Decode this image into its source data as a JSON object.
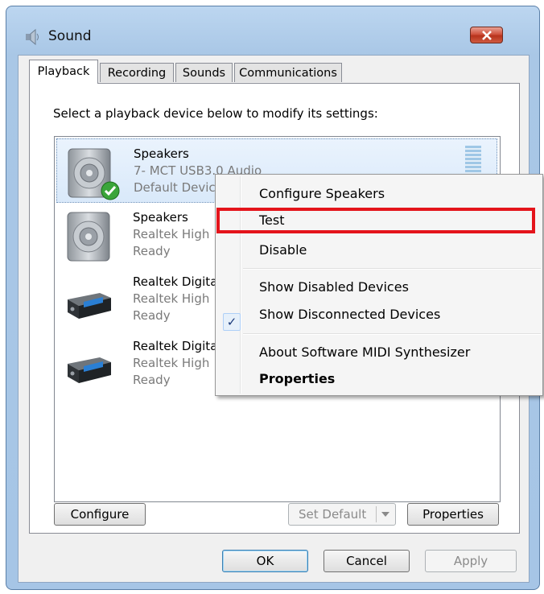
{
  "window": {
    "title": "Sound",
    "icon": "speaker-icon"
  },
  "tabs": [
    {
      "label": "Playback",
      "active": true
    },
    {
      "label": "Recording"
    },
    {
      "label": "Sounds"
    },
    {
      "label": "Communications"
    }
  ],
  "instructions": "Select a playback device below to modify its settings:",
  "devices": [
    {
      "name": "Speakers",
      "line2": "7- MCT USB3.0 Audio",
      "line3": "Default Device",
      "icon": "speaker-icon",
      "selected": true,
      "default": true
    },
    {
      "name": "Speakers",
      "line2": "Realtek High",
      "line3": "Ready",
      "icon": "speaker-icon"
    },
    {
      "name": "Realtek Digita",
      "line2": "Realtek High",
      "line3": "Ready",
      "icon": "receiver-icon"
    },
    {
      "name": "Realtek Digita",
      "line2": "Realtek High",
      "line3": "Ready",
      "icon": "receiver-icon"
    }
  ],
  "context_menu": {
    "items": [
      {
        "label": "Configure Speakers"
      },
      {
        "label": "Test",
        "highlighted": true
      },
      {
        "label": "Disable"
      },
      {
        "label": "Show Disabled Devices"
      },
      {
        "label": "Show Disconnected Devices",
        "checked": true
      },
      {
        "label": "About Software MIDI Synthesizer"
      },
      {
        "label": "Properties",
        "bold": true
      }
    ],
    "highlight_color": "#e4141b"
  },
  "panel_buttons": {
    "configure": "Configure",
    "set_default": "Set Default",
    "properties": "Properties"
  },
  "dialog_buttons": {
    "ok": "OK",
    "cancel": "Cancel",
    "apply": "Apply"
  }
}
